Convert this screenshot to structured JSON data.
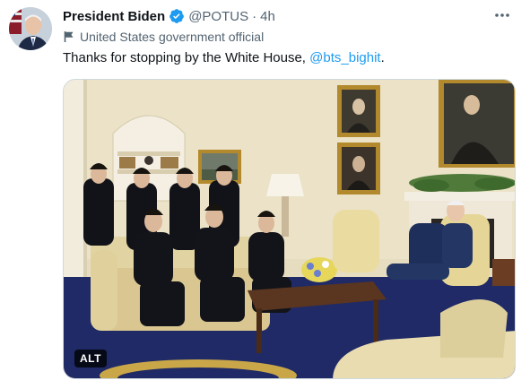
{
  "tweet": {
    "author_name": "President Biden",
    "handle": "@POTUS",
    "separator": "·",
    "time": "4h",
    "label": "United States government official",
    "text_main": "Thanks for stopping by the White House, ",
    "mention": "@bts_bighit",
    "text_end": ".",
    "more_icon": "more-horizontal-icon",
    "verified_icon": "verified-badge-icon",
    "label_icon": "flag-icon"
  },
  "media": {
    "alt_badge": "ALT"
  },
  "colors": {
    "link": "#1d9bf0",
    "verified": "#1d9bf0",
    "secondary_text": "#536471",
    "carpet": "#1f2a66"
  }
}
